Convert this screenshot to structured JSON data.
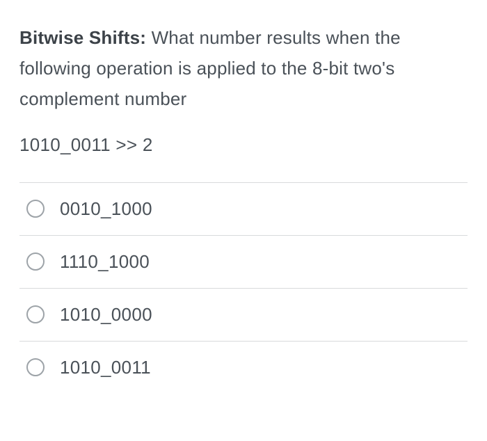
{
  "question": {
    "title": "Bitwise Shifts:",
    "text": " What number results when the following operation is applied to the 8-bit two's complement number",
    "expression": "1010_0011 >> 2"
  },
  "options": [
    {
      "label": "0010_1000"
    },
    {
      "label": "1110_1000"
    },
    {
      "label": "1010_0000"
    },
    {
      "label": "1010_0011"
    }
  ]
}
